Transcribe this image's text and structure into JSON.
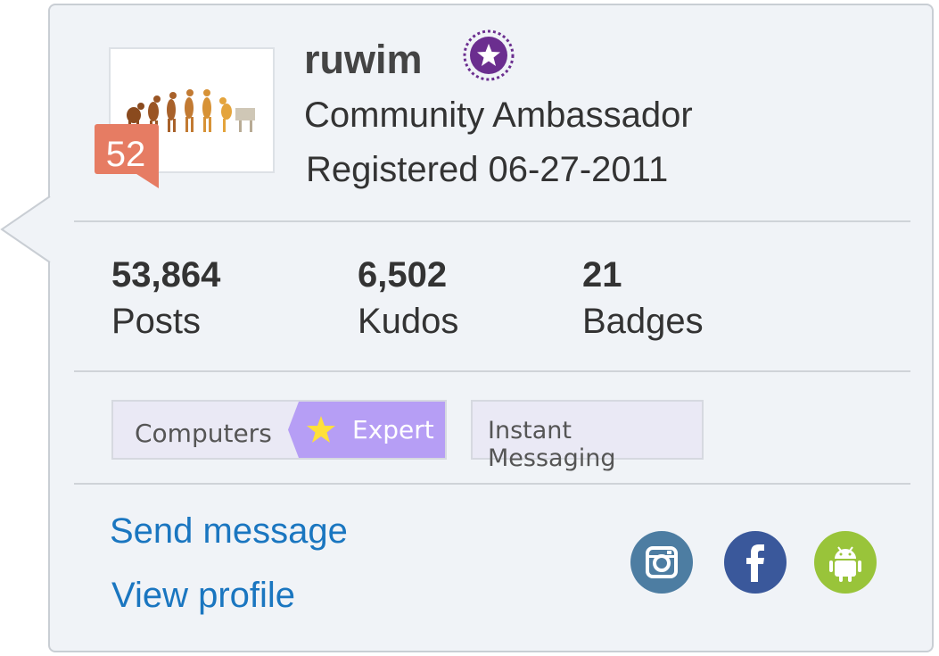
{
  "user": {
    "username": "ruwim",
    "rank_title": "Community Ambassador",
    "registered": "Registered 06-27-2011",
    "rank_badge_number": "52",
    "badge_icon": "star-icon",
    "badge_color": "#6b2e8f"
  },
  "stats": [
    {
      "value": "53,864",
      "label": "Posts"
    },
    {
      "value": "6,502",
      "label": "Kudos"
    },
    {
      "value": "21",
      "label": "Badges"
    }
  ],
  "tags": {
    "computers": {
      "label": "Computers",
      "expert_label": "Expert",
      "expert_icon": "star-icon"
    },
    "instant_messaging": {
      "label": "Instant Messaging"
    }
  },
  "actions": {
    "send_message": "Send message",
    "view_profile": "View profile"
  },
  "social": [
    {
      "icon": "instagram-icon",
      "color": "#4d7da2"
    },
    {
      "icon": "facebook-icon",
      "color": "#3a589b"
    },
    {
      "icon": "android-icon",
      "color": "#99c43a"
    }
  ],
  "colors": {
    "link": "#1a76c0",
    "rank_badge": "#e67c63",
    "expert": "#b69ef5"
  }
}
